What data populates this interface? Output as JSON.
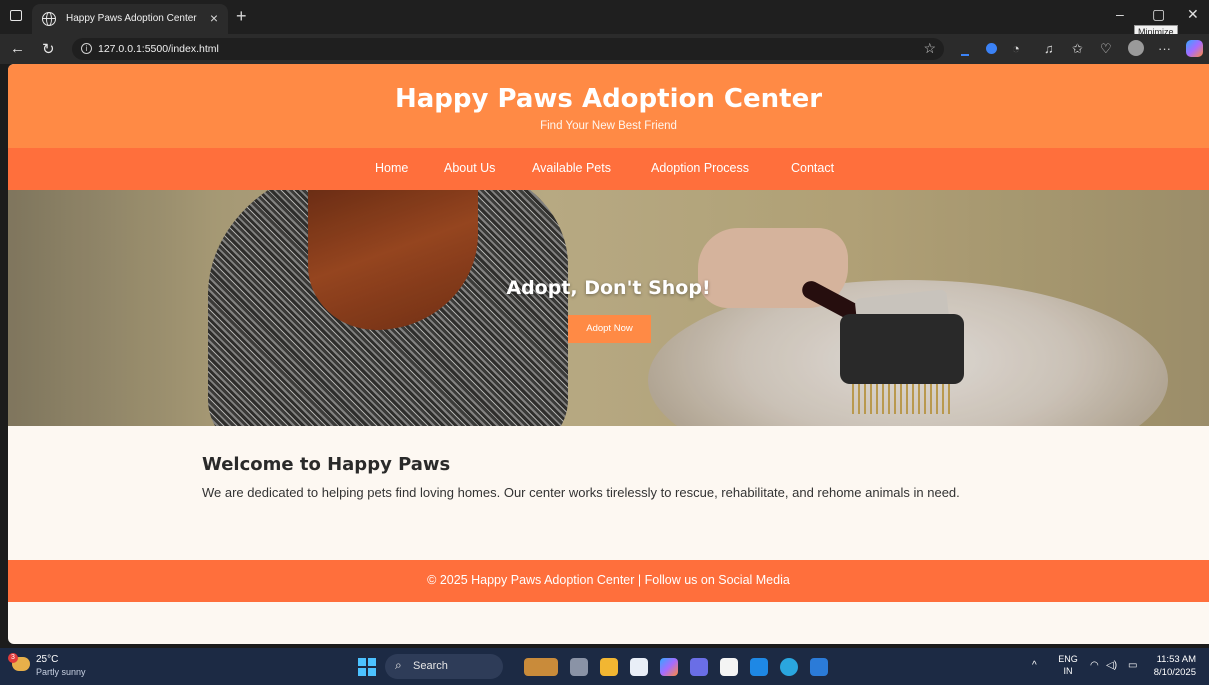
{
  "browser": {
    "tab_title": "Happy Paws Adoption Center",
    "tab_close": "×",
    "new_tab": "+",
    "url": "127.0.0.1:5500/index.html",
    "tooltip": "Minimize",
    "window_minimize": "–",
    "window_maximize": "▢",
    "window_close": "✕"
  },
  "site": {
    "title": "Happy Paws Adoption Center",
    "tagline": "Find Your New Best Friend",
    "nav": [
      "Home",
      "About Us",
      "Available Pets",
      "Adoption Process",
      "Contact"
    ],
    "hero": {
      "heading": "Adopt, Don't Shop!",
      "button": "Adopt Now"
    },
    "welcome": {
      "heading": "Welcome to Happy Paws",
      "body": "We are dedicated to helping pets find loving homes. Our center works tirelessly to rescue, rehabilitate, and rehome animals in need."
    },
    "footer": "© 2025 Happy Paws Adoption Center | Follow us on Social Media"
  },
  "taskbar": {
    "weather_badge": "3",
    "temperature": "25°C",
    "weather": "Partly sunny",
    "search": "Search",
    "lang_top": "ENG",
    "lang_bottom": "IN",
    "time": "11:53 AM",
    "date": "8/10/2025"
  },
  "colors": {
    "header": "#ff8a45",
    "nav": "#ff6f3c",
    "page_bg": "#fdf8f2"
  }
}
